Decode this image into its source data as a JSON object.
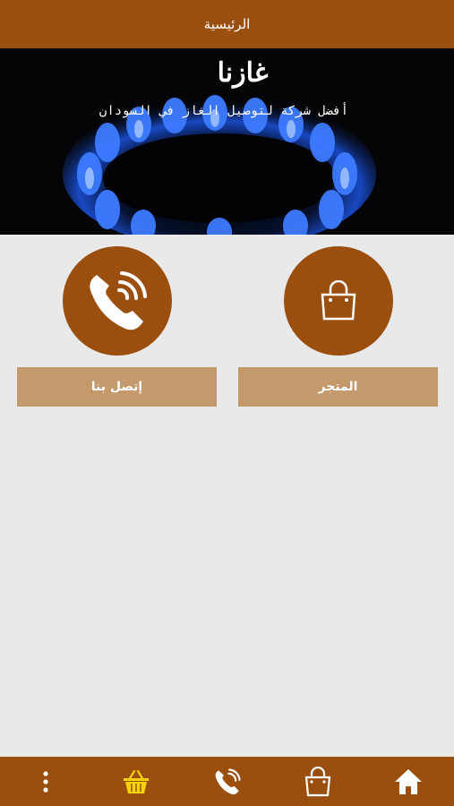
{
  "header": {
    "title": "الرئيسية"
  },
  "hero": {
    "title": "غازنا",
    "subtitle": "أفضل شركة لتوصيل الغاز في السودان"
  },
  "tiles": [
    {
      "label": "المتجر",
      "icon": "shopping-bag-icon"
    },
    {
      "label": "إتصل بنا",
      "icon": "phone-icon"
    }
  ],
  "bottom_nav": [
    {
      "icon": "home-icon"
    },
    {
      "icon": "shopping-bag-icon"
    },
    {
      "icon": "phone-icon"
    },
    {
      "icon": "basket-icon",
      "color": "#f5d400"
    },
    {
      "icon": "more-vertical-icon"
    }
  ],
  "colors": {
    "primary": "#9b4f0f",
    "button": "#c4996b",
    "background": "#e9e9e9"
  }
}
